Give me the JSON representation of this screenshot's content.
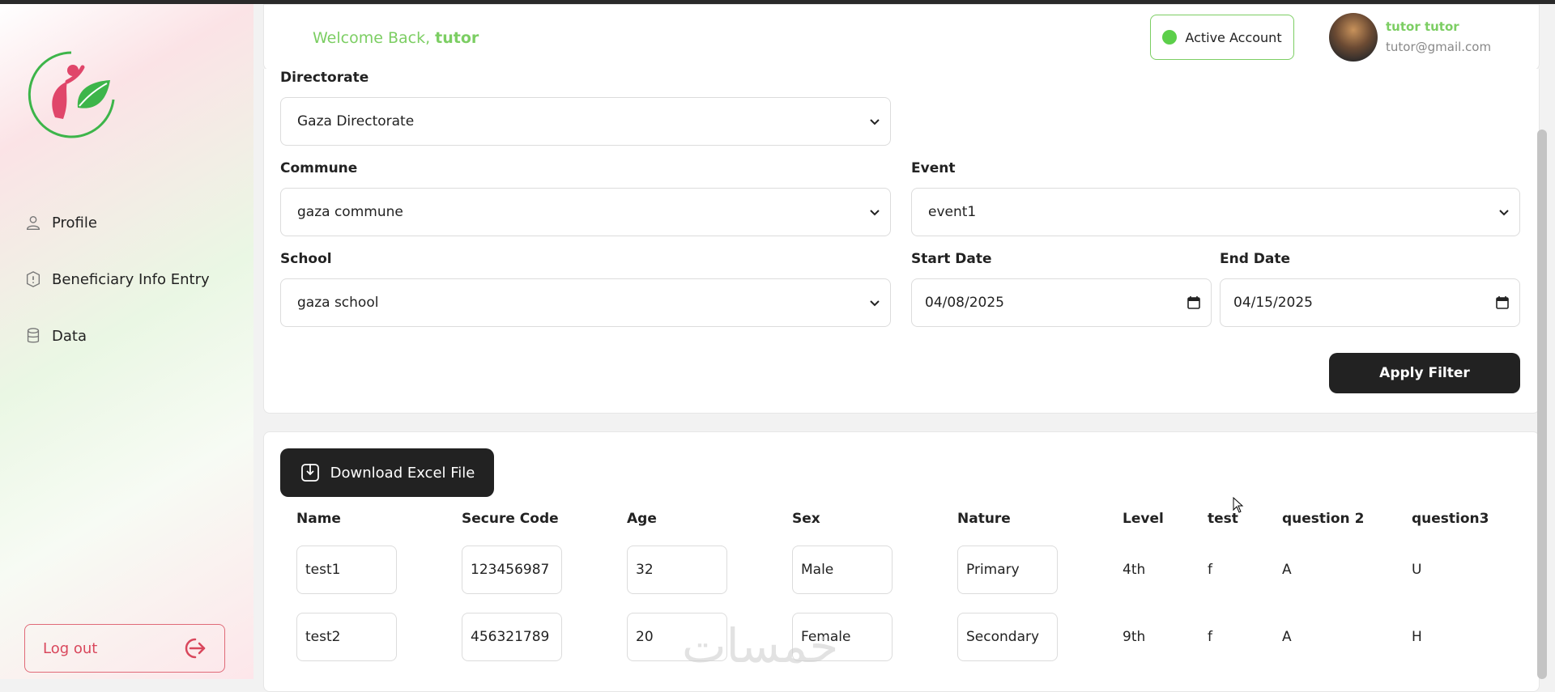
{
  "header": {
    "welcome_prefix": "Welcome Back, ",
    "welcome_user": "tutor",
    "active_label": "Active Account",
    "user_name": "tutor tutor",
    "user_email": "tutor@gmail.com"
  },
  "sidebar": {
    "items": [
      {
        "label": "Profile",
        "icon": "user-icon"
      },
      {
        "label": "Beneficiary Info Entry",
        "icon": "info-shield-icon"
      },
      {
        "label": "Data",
        "icon": "database-icon"
      }
    ],
    "logout_label": "Log out"
  },
  "filters": {
    "directorate": {
      "label": "Directorate",
      "value": "Gaza Directorate"
    },
    "commune": {
      "label": "Commune",
      "value": "gaza commune"
    },
    "event": {
      "label": "Event",
      "value": "event1"
    },
    "school": {
      "label": "School",
      "value": "gaza school"
    },
    "start_date": {
      "label": "Start Date",
      "value": "04/08/2025"
    },
    "end_date": {
      "label": "End Date",
      "value": "04/15/2025"
    },
    "apply_label": "Apply Filter"
  },
  "table": {
    "download_label": "Download Excel File",
    "columns": [
      "Name",
      "Secure Code",
      "Age",
      "Sex",
      "Nature",
      "Level",
      "test",
      "question 2",
      "question3"
    ],
    "rows": [
      [
        "test1",
        "123456987",
        "32",
        "Male",
        "Primary",
        "4th",
        "f",
        "A",
        "U"
      ],
      [
        "test2",
        "456321789",
        "20",
        "Female",
        "Secondary",
        "9th",
        "f",
        "A",
        "H"
      ]
    ]
  },
  "watermark": "خمسات",
  "colors": {
    "accent_green": "#7cce63",
    "logout_red": "#d9475c",
    "dark_button": "#222222"
  }
}
